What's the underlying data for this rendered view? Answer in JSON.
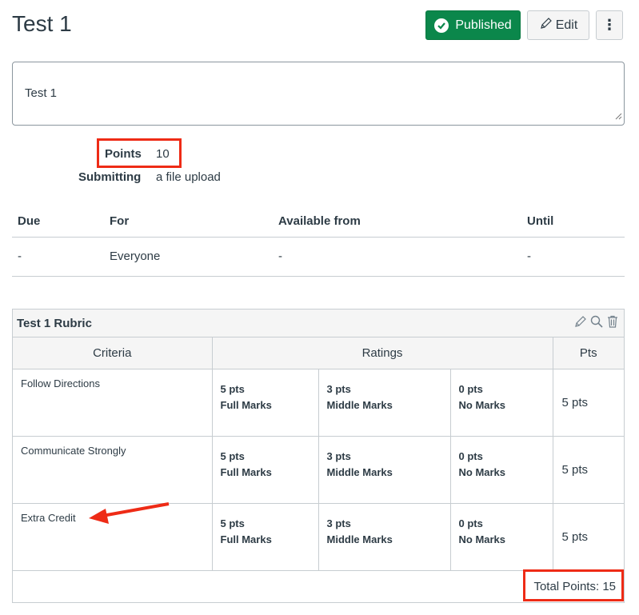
{
  "header": {
    "title": "Test 1"
  },
  "toolbar": {
    "published_label": "Published",
    "edit_label": "Edit",
    "more_label": "⋮"
  },
  "description": {
    "text": "Test 1"
  },
  "details": {
    "points_label": "Points",
    "points_value": "10",
    "submitting_label": "Submitting",
    "submitting_value": "a file upload"
  },
  "dates": {
    "headers": [
      "Due",
      "For",
      "Available from",
      "Until"
    ],
    "row": [
      "-",
      "Everyone",
      "-",
      "-"
    ]
  },
  "rubric": {
    "title": "Test 1 Rubric",
    "headers": {
      "criteria": "Criteria",
      "ratings": "Ratings",
      "pts": "Pts"
    },
    "rows": [
      {
        "criterion": "Follow Directions",
        "ratings": [
          {
            "pts": "5 pts",
            "label": "Full Marks"
          },
          {
            "pts": "3 pts",
            "label": "Middle Marks"
          },
          {
            "pts": "0 pts",
            "label": "No Marks"
          }
        ],
        "points": "5 pts"
      },
      {
        "criterion": "Communicate Strongly",
        "ratings": [
          {
            "pts": "5 pts",
            "label": "Full Marks"
          },
          {
            "pts": "3 pts",
            "label": "Middle Marks"
          },
          {
            "pts": "0 pts",
            "label": "No Marks"
          }
        ],
        "points": "5 pts"
      },
      {
        "criterion": "Extra Credit",
        "ratings": [
          {
            "pts": "5 pts",
            "label": "Full Marks"
          },
          {
            "pts": "3 pts",
            "label": "Middle Marks"
          },
          {
            "pts": "0 pts",
            "label": "No Marks"
          }
        ],
        "points": "5 pts"
      }
    ],
    "total": "Total Points: 15"
  },
  "colors": {
    "published": "#0b874b",
    "annotation": "#ee2b16",
    "text": "#2d3b45",
    "border": "#c7cdd1"
  }
}
